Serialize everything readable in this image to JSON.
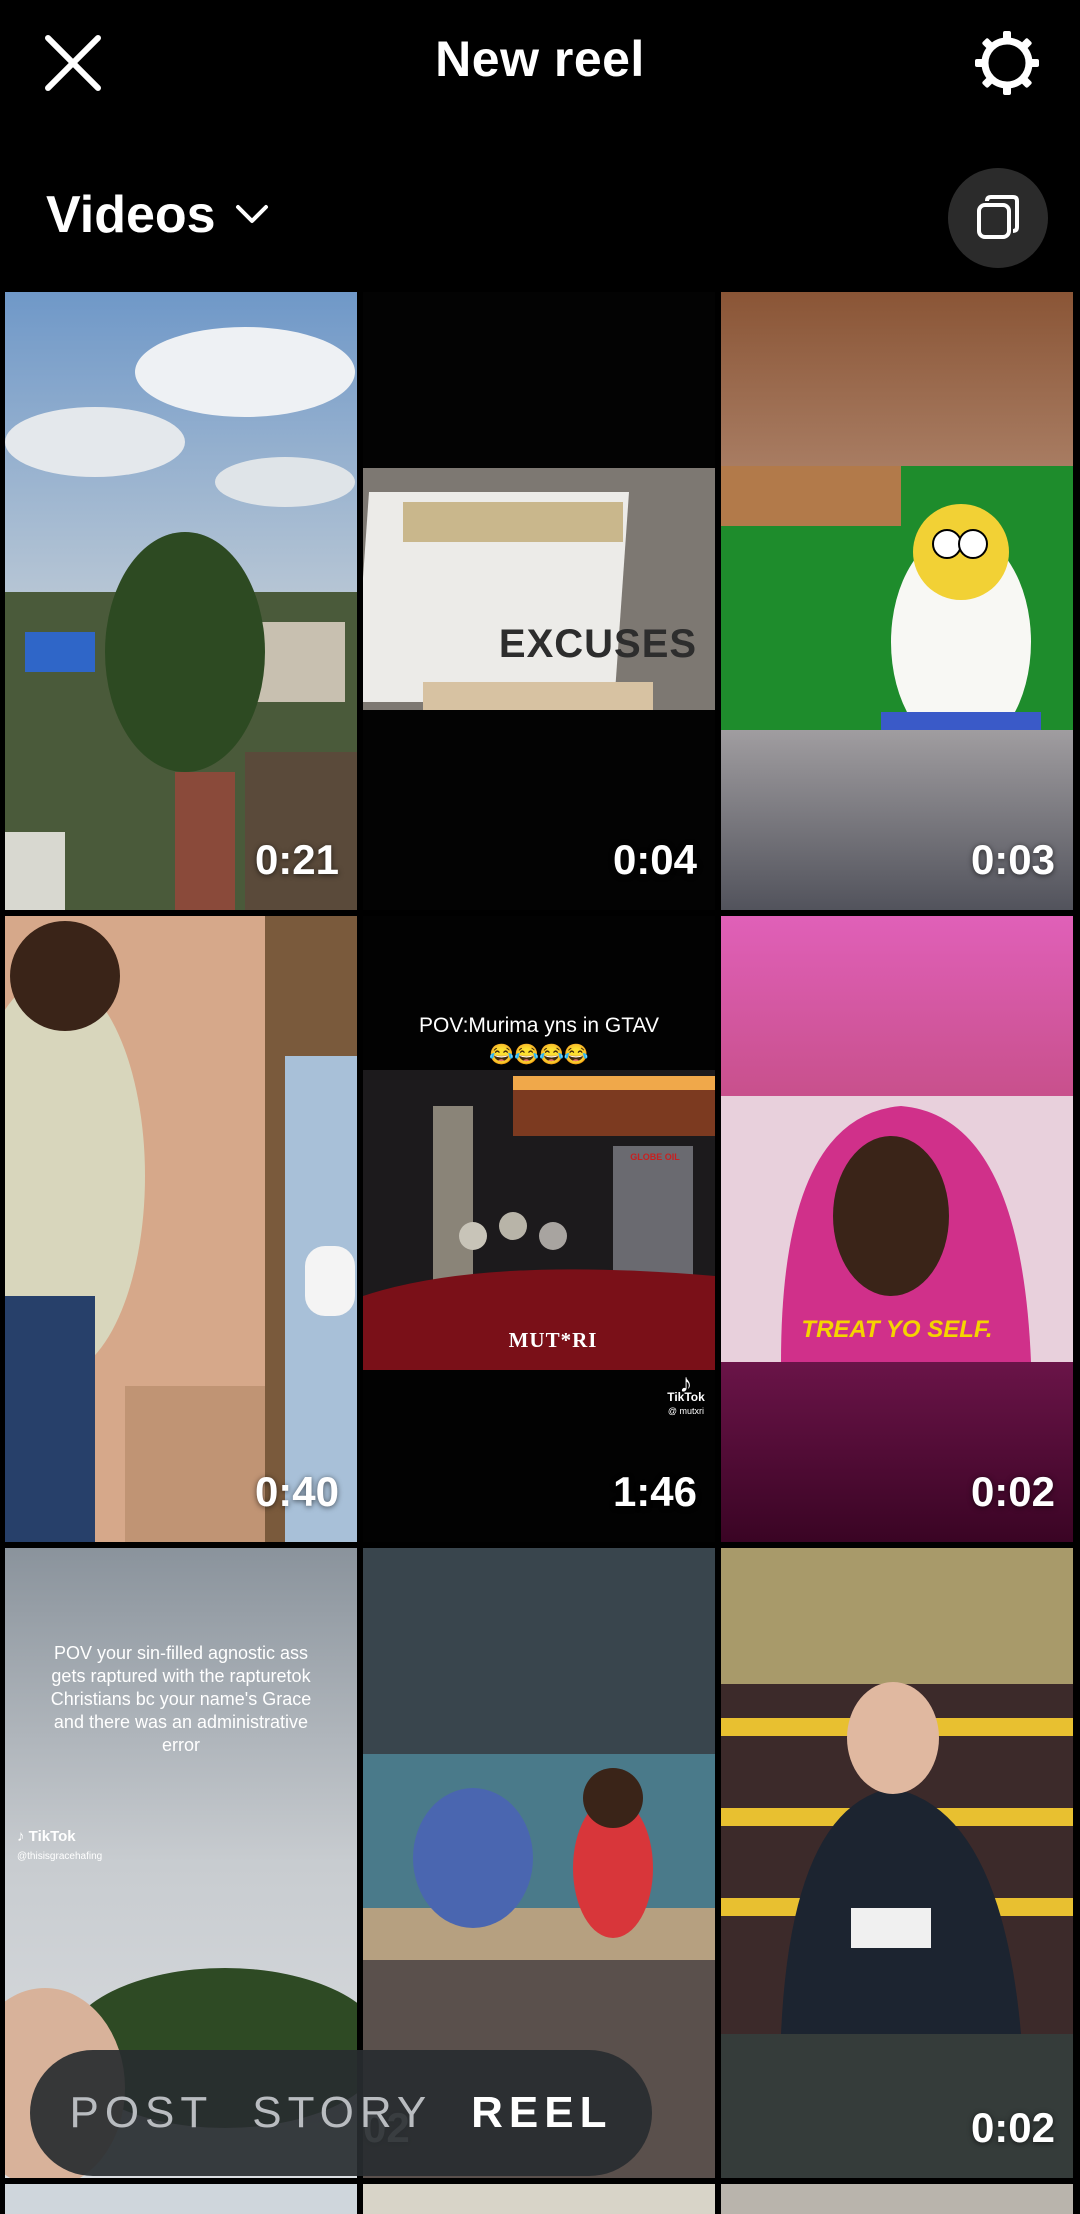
{
  "header": {
    "title": "New reel"
  },
  "source": {
    "label": "Videos"
  },
  "videos": [
    {
      "duration": "0:21",
      "overlay": ""
    },
    {
      "duration": "0:04",
      "overlay": "EXCUSES"
    },
    {
      "duration": "0:03",
      "overlay": ""
    },
    {
      "duration": "0:40",
      "overlay": ""
    },
    {
      "duration": "1:46",
      "overlay": "POV:Murima yns in GTAV",
      "overlay2": "😂😂😂😂",
      "watermark": "TikTok",
      "watermark_handle": "@ mutxri",
      "logo_text": "MUT*RI",
      "sign_text": "GLOBE OIL"
    },
    {
      "duration": "0:02",
      "overlay": "TREAT YO SELF."
    },
    {
      "duration": "",
      "overlay": "POV your sin-filled agnostic ass gets raptured with the rapturetok Christians bc your name's Grace and there was an administrative error",
      "watermark": "TikTok",
      "watermark_handle": "@thisisgracehafing"
    },
    {
      "duration": "",
      "overlay": ""
    },
    {
      "duration": "0:02",
      "overlay": ""
    }
  ],
  "hidden_duration_fragment": "02",
  "modes": {
    "post": "POST",
    "story": "STORY",
    "reel": "REEL",
    "active": "reel"
  },
  "colors": {
    "background": "#000000",
    "mode_bar": "#282c30"
  }
}
